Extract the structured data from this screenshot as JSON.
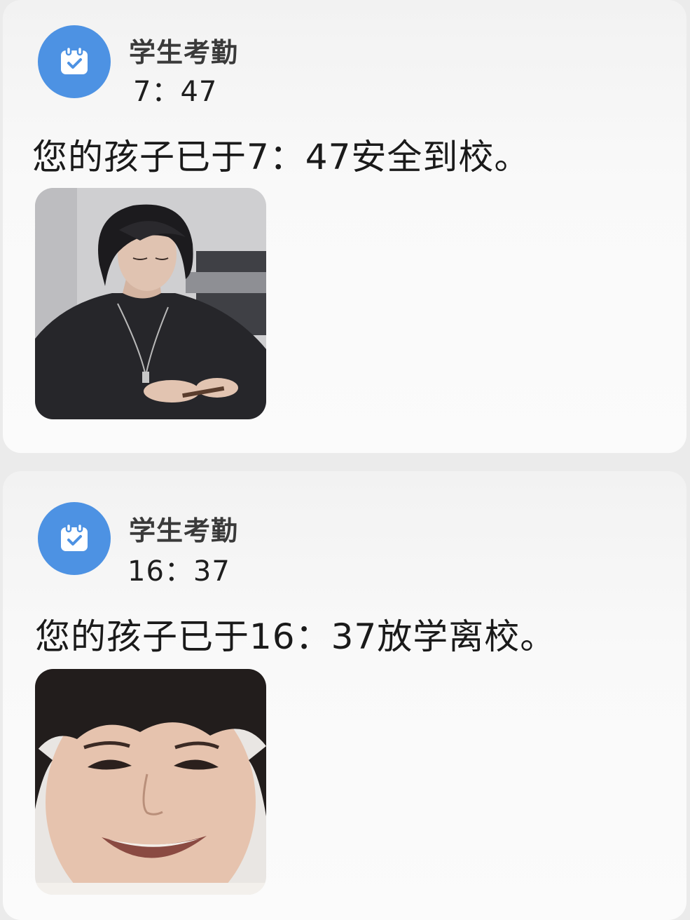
{
  "notifications": [
    {
      "app_name": "学生考勤",
      "time": "7：47",
      "message": "您的孩子已于7：47安全到校。",
      "icon": "calendar-check-icon",
      "photo": "student-photo-arrival"
    },
    {
      "app_name": "学生考勤",
      "time": "16：37",
      "message": "您的孩子已于16：37放学离校。",
      "icon": "calendar-check-icon",
      "photo": "student-photo-departure"
    }
  ],
  "colors": {
    "icon_background": "#4d92e3",
    "card_background": "#f7f7f7",
    "page_background": "#ebebeb"
  }
}
